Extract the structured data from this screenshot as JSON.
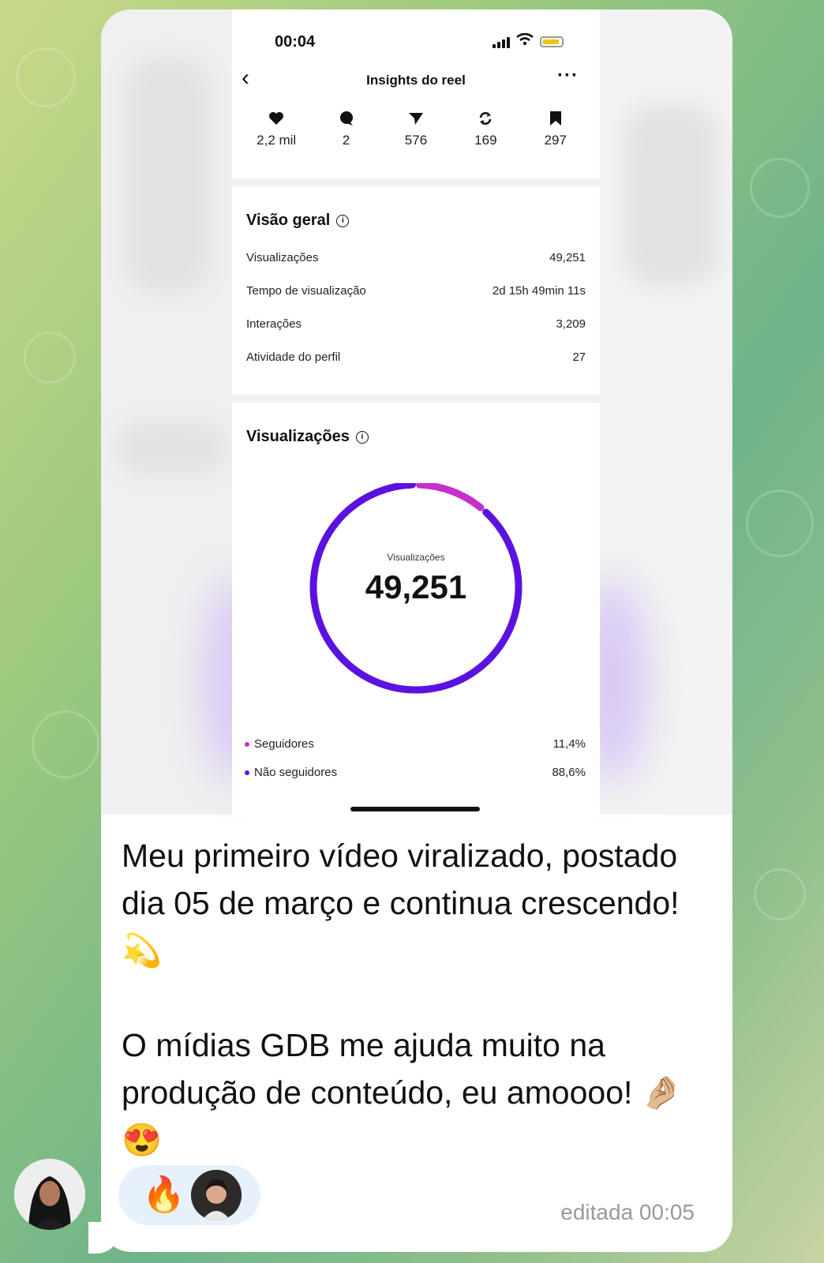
{
  "status_bar": {
    "time": "00:04"
  },
  "nav": {
    "title": "Insights do reel"
  },
  "stats": [
    {
      "icon": "heart-icon",
      "value": "2,2 mil"
    },
    {
      "icon": "comment-icon",
      "value": "2"
    },
    {
      "icon": "send-icon",
      "value": "576"
    },
    {
      "icon": "repost-icon",
      "value": "169"
    },
    {
      "icon": "bookmark-icon",
      "value": "297"
    }
  ],
  "overview": {
    "title": "Visão geral",
    "rows": [
      {
        "label": "Visualizações",
        "value": "49,251"
      },
      {
        "label": "Tempo de visualização",
        "value": "2d 15h 49min 11s"
      },
      {
        "label": "Interações",
        "value": "3,209"
      },
      {
        "label": "Atividade do perfil",
        "value": "27"
      }
    ]
  },
  "views": {
    "title": "Visualizações",
    "center_label": "Visualizações",
    "center_value": "49,251",
    "legend": [
      {
        "label": "Seguidores",
        "value": "11,4%",
        "color": "#c62fcc",
        "fraction": 0.114
      },
      {
        "label": "Não seguidores",
        "value": "88,6%",
        "color": "#5b12e0",
        "fraction": 0.886
      }
    ]
  },
  "message": {
    "text": "Meu primeiro vídeo viralizado, postado dia 05 de março e continua crescendo! 💫\n\nO mídias GDB me ajuda muito na produção de conteúdo, eu amoooo! 🤌🏼 😍",
    "reaction": "🔥",
    "edited": "editada 00:05"
  }
}
